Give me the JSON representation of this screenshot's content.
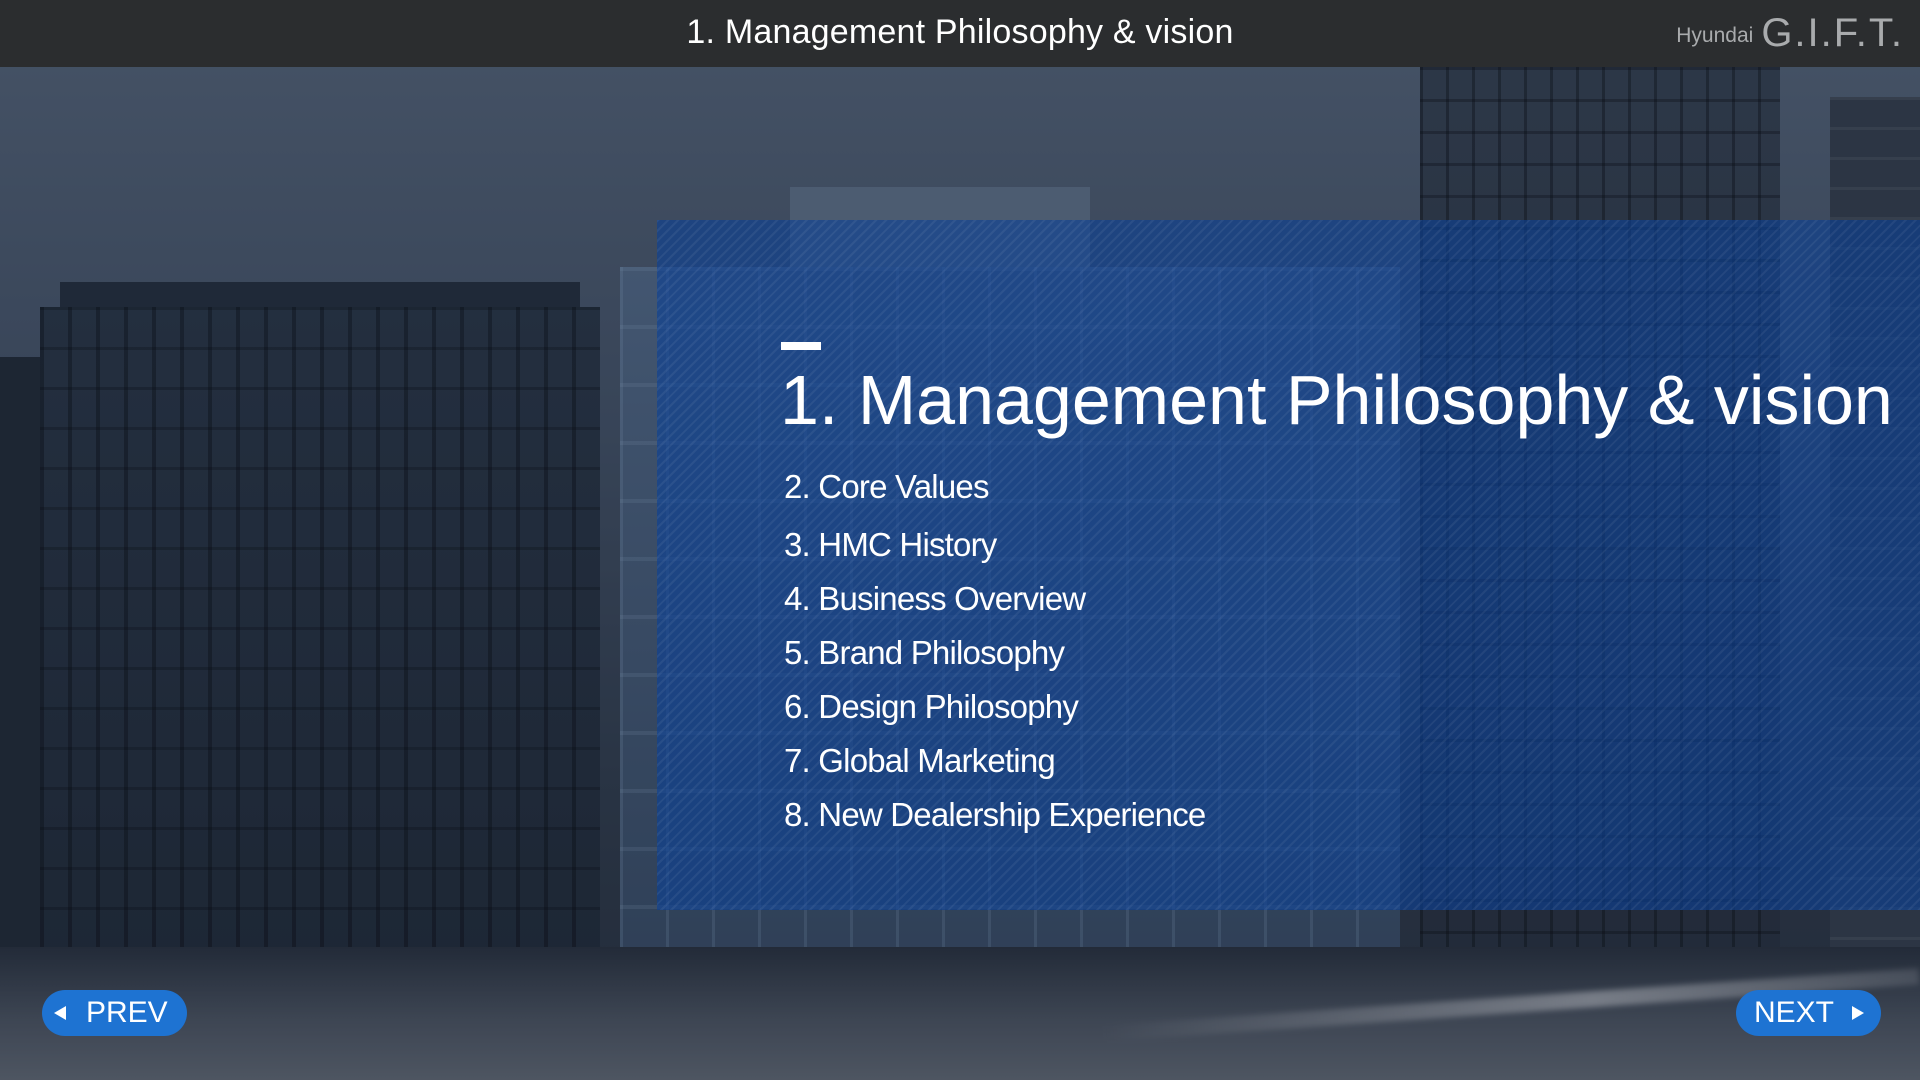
{
  "header": {
    "title": "1. Management Philosophy & vision",
    "brand_small": "Hyundai",
    "brand_large": "G.I.F.T."
  },
  "panel": {
    "heading": "1. Management Philosophy & vision",
    "items": [
      {
        "label": "2. Core Values"
      },
      {
        "label": "3. HMC History"
      },
      {
        "label": "4. Business Overview"
      },
      {
        "label": "5. Brand Philosophy"
      },
      {
        "label": "6. Design Philosophy"
      },
      {
        "label": "7. Global Marketing"
      },
      {
        "label": "8. New Dealership Experience"
      }
    ]
  },
  "nav": {
    "prev_label": "PREV",
    "next_label": "NEXT",
    "prev_icon": "arrow-left-icon",
    "next_icon": "arrow-right-icon"
  },
  "colors": {
    "header_bg": "#2b2d2f",
    "panel_blue": "#0c4096",
    "button_blue": "#1e73d2",
    "brand_gray": "#a9abad"
  }
}
